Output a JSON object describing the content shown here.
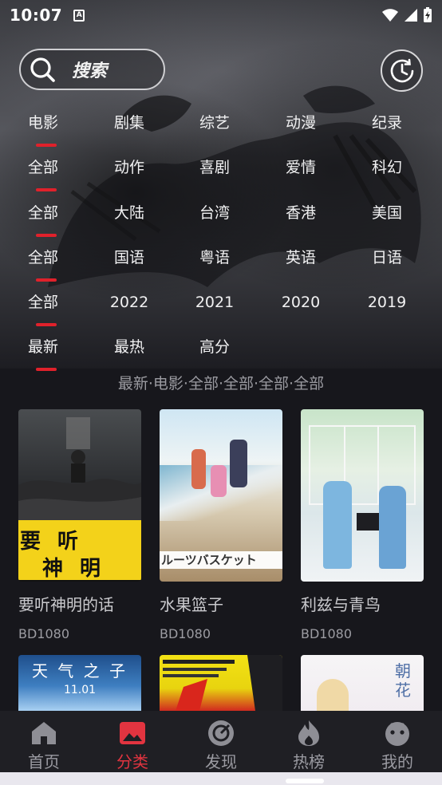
{
  "status_bar": {
    "time": "10:07",
    "a_icon": "A"
  },
  "search": {
    "label": "搜索"
  },
  "filters": [
    {
      "items": [
        "电影",
        "剧集",
        "综艺",
        "动漫",
        "纪录"
      ],
      "active": 0
    },
    {
      "items": [
        "全部",
        "动作",
        "喜剧",
        "爱情",
        "科幻"
      ],
      "active": 0
    },
    {
      "items": [
        "全部",
        "大陆",
        "台湾",
        "香港",
        "美国"
      ],
      "active": 0
    },
    {
      "items": [
        "全部",
        "国语",
        "粤语",
        "英语",
        "日语"
      ],
      "active": 0
    },
    {
      "items": [
        "全部",
        "2022",
        "2021",
        "2020",
        "2019"
      ],
      "active": 0
    },
    {
      "items": [
        "最新",
        "最热",
        "高分"
      ],
      "active": 0
    }
  ],
  "breadcrumb": "最新·电影·全部·全部·全部·全部",
  "cards": [
    {
      "title": "要听神明的话",
      "badge": "BD1080",
      "poster_text_1": "要 听",
      "poster_text_2": "神 明 的 话"
    },
    {
      "title": "水果篮子",
      "badge": "BD1080",
      "poster_text": "ルーツバスケット"
    },
    {
      "title": "利兹与青鸟",
      "badge": "BD1080"
    },
    {
      "title": "",
      "badge": "",
      "poster_text_1": "天 气 之 子",
      "poster_text_2": "11.01"
    },
    {
      "title": "",
      "badge": ""
    },
    {
      "title": "",
      "badge": "",
      "poster_text": "朝 花"
    }
  ],
  "nav": [
    {
      "label": "首页",
      "icon": "home-icon"
    },
    {
      "label": "分类",
      "icon": "category-icon"
    },
    {
      "label": "发现",
      "icon": "discover-icon"
    },
    {
      "label": "热榜",
      "icon": "fire-icon"
    },
    {
      "label": "我的",
      "icon": "profile-icon"
    }
  ],
  "colors": {
    "accent": "#e0212b",
    "background": "#17171c",
    "nav_bg": "#1f1f24"
  }
}
